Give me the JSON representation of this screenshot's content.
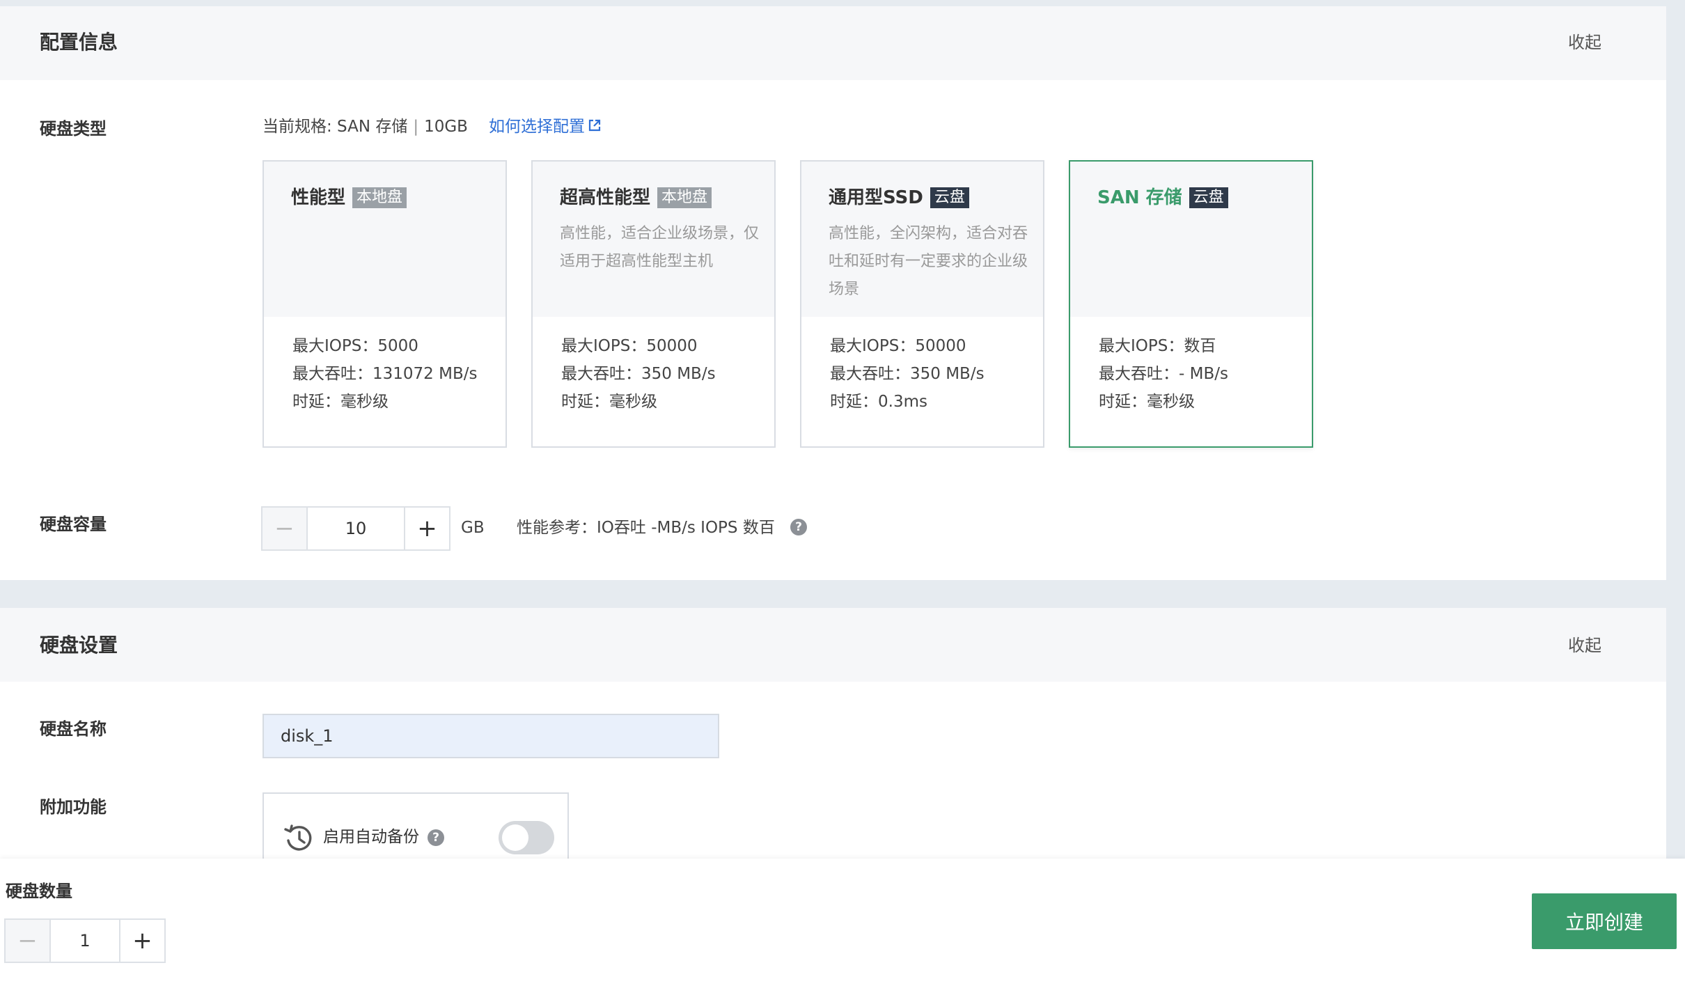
{
  "config_section": {
    "title": "配置信息",
    "collapse_label": "收起",
    "disk_type": {
      "label": "硬盘类型",
      "current_spec": "当前规格: SAN 存储",
      "current_size": "10GB",
      "separator": "|",
      "help_link": "如何选择配置",
      "cards": [
        {
          "name": "性能型",
          "badge": "本地盘",
          "description": "",
          "iops": "最大IOPS：5000",
          "throughput": "最大吞吐：131072 MB/s",
          "latency": "时延：毫秒级",
          "selected": false
        },
        {
          "name": "超高性能型",
          "badge": "本地盘",
          "description": "高性能，适合企业级场景，仅适用于超高性能型主机",
          "iops": "最大IOPS：50000",
          "throughput": "最大吞吐：350 MB/s",
          "latency": "时延：毫秒级",
          "selected": false
        },
        {
          "name": "通用型SSD",
          "badge": "云盘",
          "description": "高性能，全闪架构，适合对吞吐和延时有一定要求的企业级场景",
          "iops": "最大IOPS：50000",
          "throughput": "最大吞吐：350 MB/s",
          "latency": "时延：0.3ms",
          "selected": false
        },
        {
          "name": "SAN 存储",
          "badge": "云盘",
          "description": "",
          "iops": "最大IOPS：数百",
          "throughput": "最大吞吐：- MB/s",
          "latency": "时延：毫秒级",
          "selected": true
        }
      ]
    },
    "capacity": {
      "label": "硬盘容量",
      "value": "10",
      "unit": "GB",
      "perf_reference": "性能参考：IO吞吐 -MB/s IOPS 数百"
    }
  },
  "disk_settings": {
    "title": "硬盘设置",
    "collapse_label": "收起",
    "name_label": "硬盘名称",
    "name_value": "disk_1",
    "features_label": "附加功能",
    "auto_backup_label": "启用自动备份",
    "auto_backup_enabled": false
  },
  "bottom_bar": {
    "quantity_label": "硬盘数量",
    "quantity_value": "1",
    "create_button": "立即创建"
  },
  "colors": {
    "accent_green": "#3a9b6b",
    "link_blue": "#2f6fd6",
    "badge_dark": "#2f3a4a",
    "badge_gray": "#9aa0a6"
  }
}
